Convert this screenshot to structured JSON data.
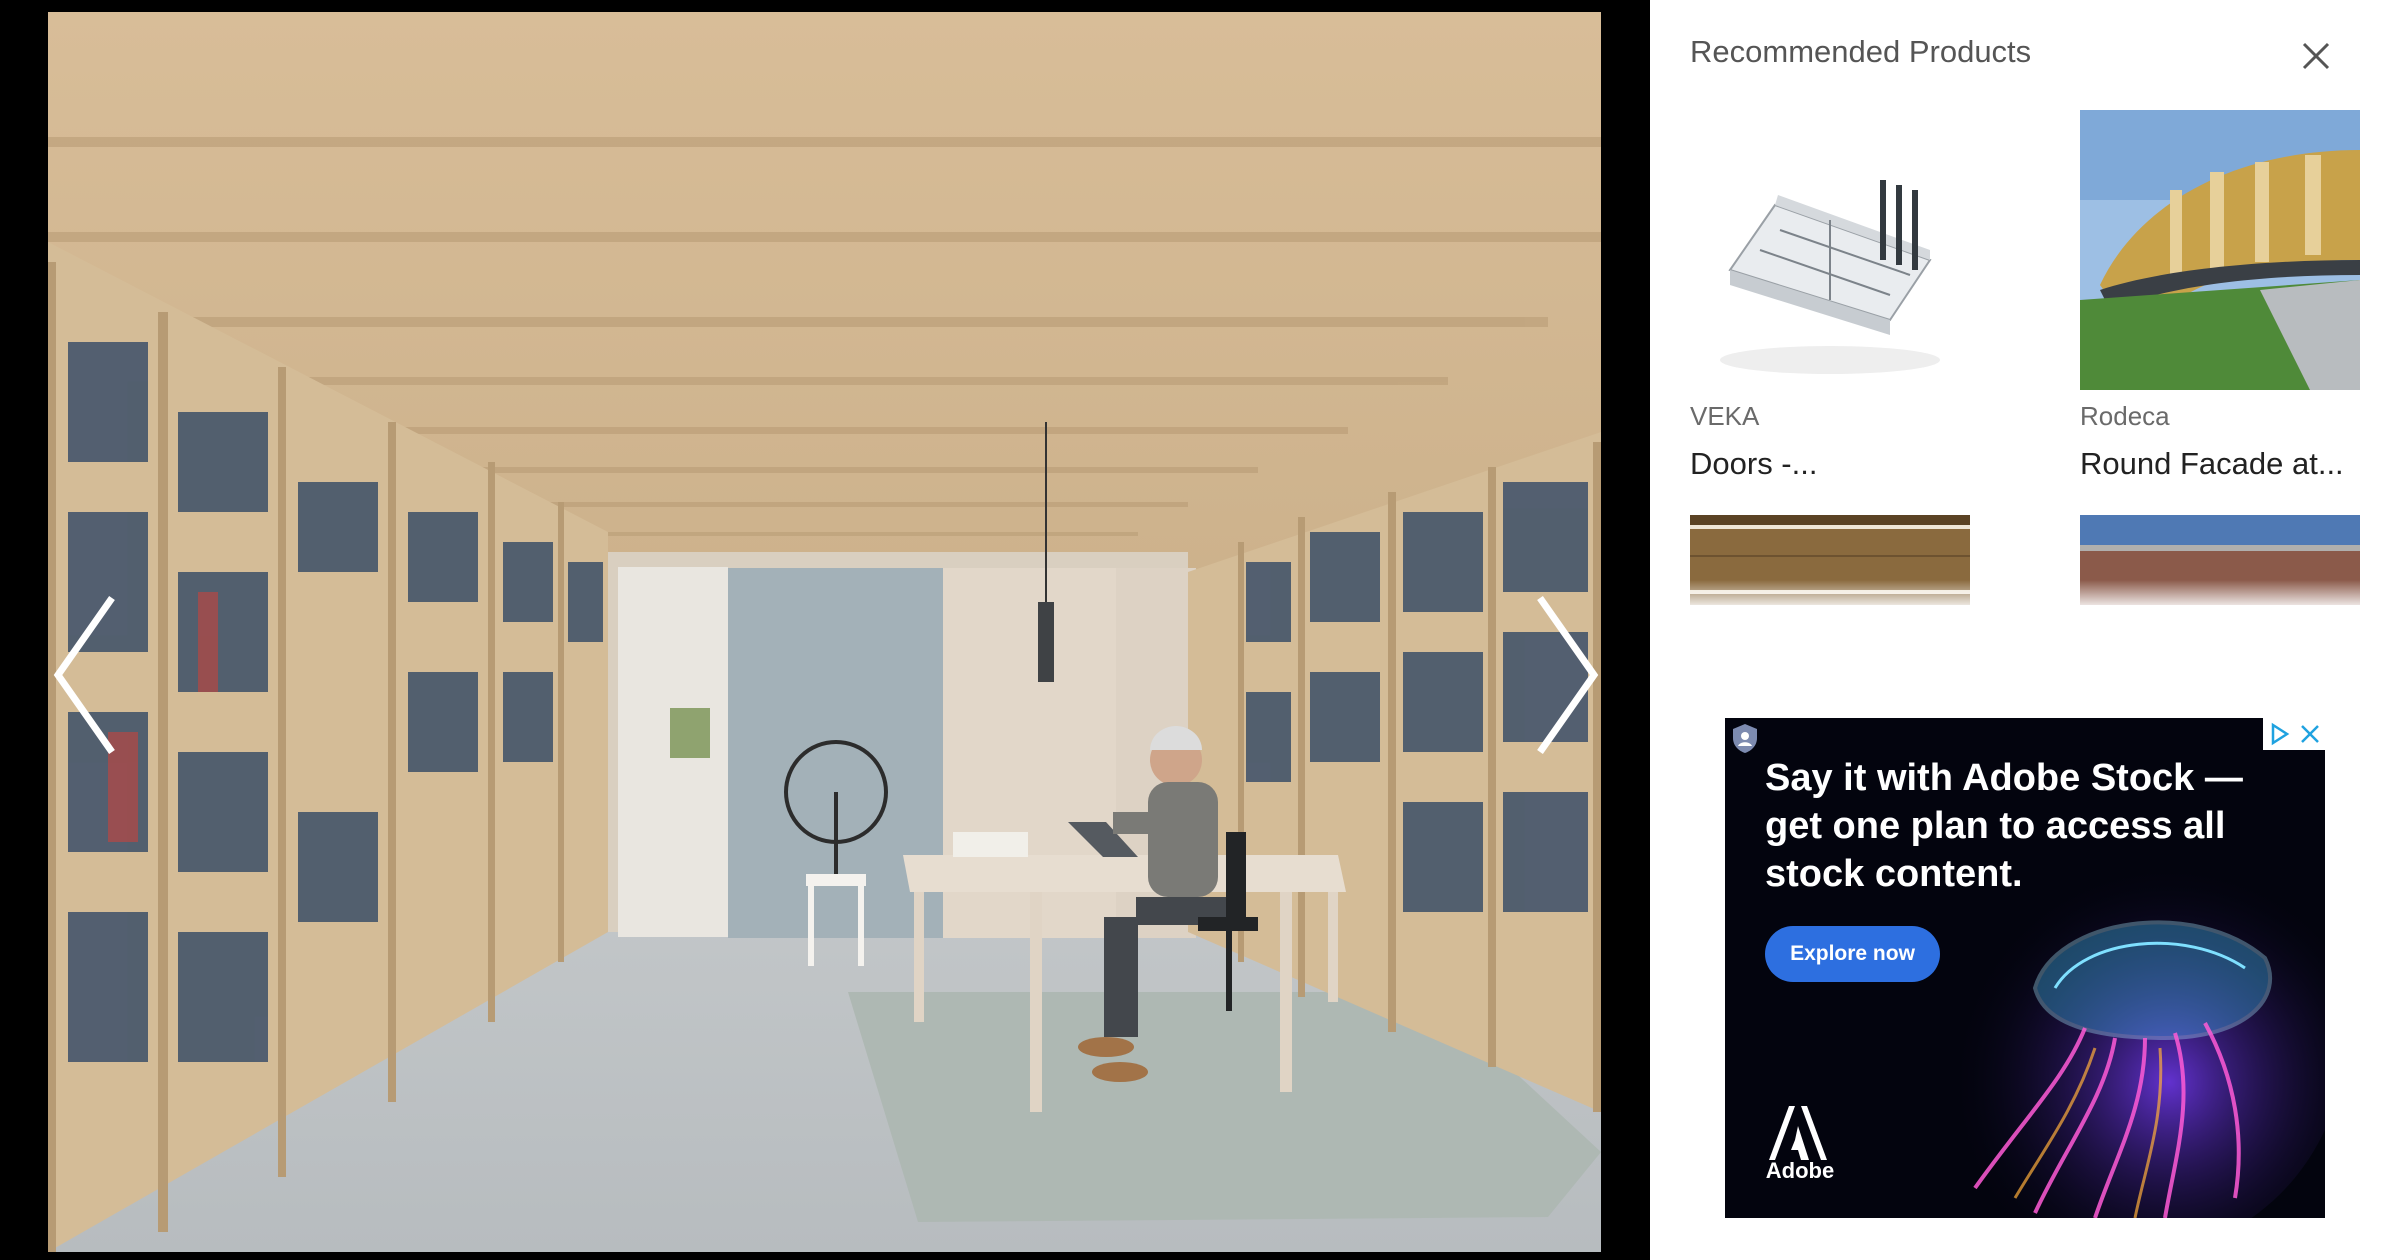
{
  "viewer": {
    "photo_alt": "Interior with wooden ceiling beams and bookshelves, man working at a table",
    "prev_icon": "chevron-left-icon",
    "next_icon": "chevron-right-icon"
  },
  "panel": {
    "title": "Recommended Products",
    "close_icon": "close-icon",
    "products": [
      {
        "brand": "VEKA",
        "name": "Doors -..."
      },
      {
        "brand": "Rodeca",
        "name": "Round Facade at..."
      }
    ]
  },
  "ad": {
    "headline": "Say it with Adobe Stock — get one plan to access all stock content.",
    "cta": "Explore now",
    "brand": "Adobe",
    "colors": {
      "background": "#03040e",
      "cta": "#2d6fe0"
    }
  }
}
